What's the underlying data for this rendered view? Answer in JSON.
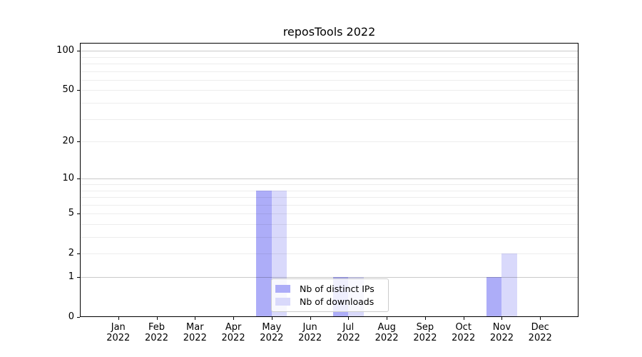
{
  "chart_data": {
    "type": "bar",
    "title": "reposTools 2022",
    "categories": [
      "Jan",
      "Feb",
      "Mar",
      "Apr",
      "May",
      "Jun",
      "Jul",
      "Aug",
      "Sep",
      "Oct",
      "Nov",
      "Dec"
    ],
    "x_tick_year": "2022",
    "series": [
      {
        "name": "Nb of distinct IPs",
        "color": "#adadf8",
        "values": [
          0,
          0,
          0,
          0,
          8,
          0,
          1,
          0,
          0,
          0,
          1,
          0
        ]
      },
      {
        "name": "Nb of downloads",
        "color": "#d9d9fb",
        "values": [
          0,
          0,
          0,
          0,
          8,
          0,
          1,
          0,
          0,
          0,
          2,
          0
        ]
      }
    ],
    "y_axis": {
      "ticks": [
        0,
        1,
        2,
        5,
        10,
        20,
        50,
        100
      ],
      "minor_gridlines": [
        3,
        4,
        6,
        7,
        8,
        9,
        30,
        40,
        60,
        70,
        80,
        90
      ],
      "scale": "log1p",
      "ylim": [
        0,
        115
      ]
    },
    "grid": true,
    "legend": {
      "position": "lower center"
    },
    "colors": {
      "grid_major": "#c9c9c9",
      "grid_minor": "#ececec",
      "spine": "#000000",
      "background": "#ffffff"
    }
  }
}
